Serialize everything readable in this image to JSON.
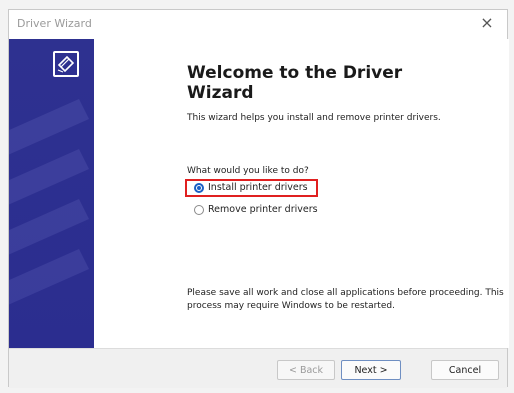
{
  "window": {
    "title": "Driver Wizard",
    "close_glyph": "×"
  },
  "banner": {
    "icon": "printer-icon",
    "color": "#2e3190"
  },
  "content": {
    "heading": "Welcome to the Driver Wizard",
    "intro": "This wizard helps you install and remove printer drivers.",
    "question": "What would you like to do?",
    "options": [
      {
        "label": "Install printer drivers",
        "selected": true
      },
      {
        "label": "Remove printer drivers",
        "selected": false
      }
    ],
    "notice": "Please save all work and close all applications before proceeding.  This process may require Windows to be restarted."
  },
  "footer": {
    "back_label": "< Back",
    "next_label": "Next >",
    "cancel_label": "Cancel"
  },
  "colors": {
    "highlight": "#e02020",
    "accent": "#1b5fc4"
  }
}
